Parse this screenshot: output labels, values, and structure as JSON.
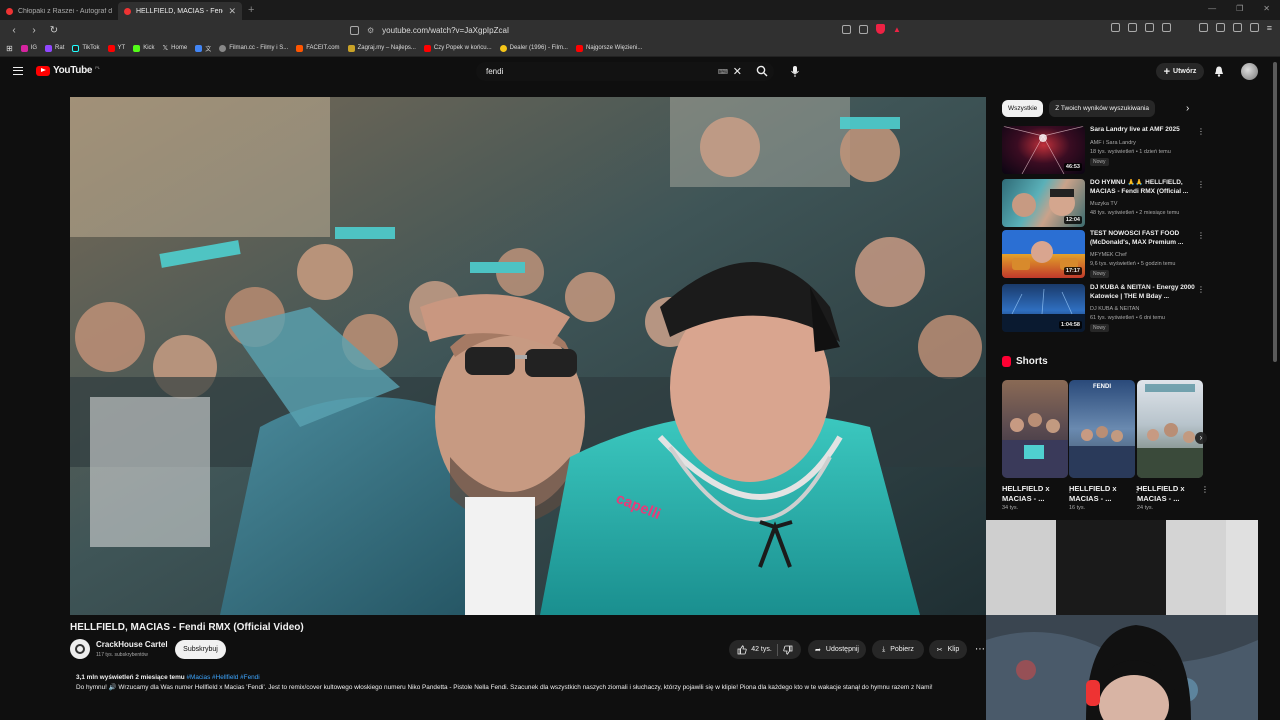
{
  "browser": {
    "tabs": [
      {
        "title": "Chłopaki z Raszei - Autograf dla kum",
        "active": false
      },
      {
        "title": "HELLFIELD, MACIAS - Fendi R",
        "active": true
      }
    ],
    "url": "youtube.com/watch?v=JaXgpIpZcaI",
    "bookmarks": [
      "IG",
      "Rat",
      "TikTok",
      "YT",
      "Kick",
      "Home",
      "Filman.cc - Filmy i S...",
      "FACEIT.com",
      "Zagraj.my – Najleps...",
      "Czy Popek w końcu...",
      "Dealer (1996) - Film...",
      "Najgorsze Więzieni..."
    ]
  },
  "header": {
    "logo": "YouTube",
    "region": "PL",
    "search_value": "fendi",
    "create_label": "Utwórz"
  },
  "video": {
    "title": "HELLFIELD, MACIAS - Fendi RMX (Official Video)",
    "channel": "CrackHouse Cartel",
    "subscribers": "117 tys. subskrybentów",
    "subscribe_label": "Subskrybuj",
    "likes": "42 tys.",
    "share_label": "Udostępnij",
    "download_label": "Pobierz",
    "clip_label": "Klip",
    "views_date": "3,1 mln wyświetleń  2 miesiące temu",
    "hashtags": "#Macias #Hellfield #Fendi",
    "description": "Do hymnu! 🔊 Wrzucamy dla Was numer Hellfield x Macias 'Fendi'. Jest to remix/cover kultowego włoskiego numeru Niko Pandetta - Pistole Nella Fendi. Szacunek dla wszystkich naszych ziomali i słuchaczy, którzy pojawili się w klipie! Piona dla każdego kto w te wakacje stanął do hymnu razem z Nami!"
  },
  "sidebar": {
    "chips": [
      "Wszystkie",
      "Z Twoich wyników wyszukiwania"
    ],
    "recommendations": [
      {
        "title": "Sara Landry live at AMF 2025",
        "channel": "AMF i Sara Landry",
        "meta": "18 tys. wyświetleń • 1 dzień temu",
        "badge": "Nowy",
        "duration": "46:53"
      },
      {
        "title": "DO HYMNU 🙏🙏 HELLFIELD, MACIAS - Fendi RMX (Official ...",
        "channel": "Muzyka TV",
        "meta": "48 tys. wyświetleń • 2 miesiące temu",
        "badge": "",
        "duration": "12:04"
      },
      {
        "title": "TEST NOWOŚCI FAST FOOD (McDonald's, MAX Premium ...",
        "channel": "MFYMEK Chef",
        "meta": "9,6 tys. wyświetleń • 5 godzin temu",
        "badge": "Nowy",
        "duration": "17:17"
      },
      {
        "title": "DJ KUBA & NEITAN - Energy 2000 Katowice | THE M Bday ...",
        "channel": "DJ KUBA & NEITAN",
        "meta": "61 tys. wyświetleń • 6 dni temu",
        "badge": "Nowy",
        "duration": "1:04:58"
      }
    ],
    "shorts_title": "Shorts",
    "shorts": [
      {
        "title": "HELLFIELD x MACIAS - ...",
        "views": "34 tys."
      },
      {
        "title": "HELLFIELD x MACIAS - ...",
        "views": "16 tys."
      },
      {
        "title": "HELLFIELD x MACIAS - ...",
        "views": "24 tys."
      }
    ],
    "short_banner": "FENDI"
  },
  "colors": {
    "accent": "#ff0000",
    "background": "#0f0f0f",
    "link": "#3ea6ff"
  }
}
